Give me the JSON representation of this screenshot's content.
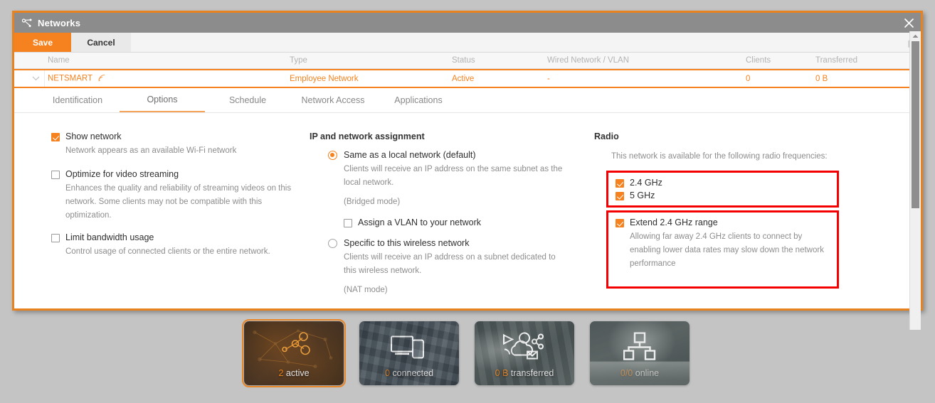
{
  "window": {
    "title": "Networks",
    "title_icon": "network-nodes-icon",
    "close_icon": "close-icon"
  },
  "toolbar": {
    "save_label": "Save",
    "cancel_label": "Cancel",
    "tools_icon": "wrench-icon"
  },
  "table": {
    "columns": [
      "Name",
      "Type",
      "Status",
      "Wired Network / VLAN",
      "Clients",
      "Transferred"
    ],
    "row": {
      "expander_icon": "chevron-down-icon",
      "name": "NETSMART",
      "name_icon": "wifi-icon",
      "type": "Employee Network",
      "status": "Active",
      "vlan": "-",
      "clients": "0",
      "transferred": "0 B"
    }
  },
  "tabs": [
    {
      "label": "Identification",
      "active": false
    },
    {
      "label": "Options",
      "active": true
    },
    {
      "label": "Schedule",
      "active": false
    },
    {
      "label": "Network Access",
      "active": false
    },
    {
      "label": "Applications",
      "active": false
    }
  ],
  "options_column": {
    "items": [
      {
        "label": "Show network",
        "checked": true,
        "desc": "Network appears as an available Wi-Fi network"
      },
      {
        "label": "Optimize for video streaming",
        "checked": false,
        "desc": "Enhances the quality and reliability of streaming videos on this network. Some clients may not be compatible with this optimization."
      },
      {
        "label": "Limit bandwidth usage",
        "checked": false,
        "desc": "Control usage of connected clients or the entire network."
      }
    ]
  },
  "ip_assignment": {
    "title": "IP and network assignment",
    "option_local": {
      "label": "Same as a local network (default)",
      "selected": true,
      "desc": "Clients will receive an IP address on the same subnet as the local network.",
      "mode": "(Bridged mode)"
    },
    "vlan_checkbox": {
      "label": "Assign a VLAN to your network",
      "checked": false
    },
    "option_specific": {
      "label": "Specific to this wireless network",
      "selected": false,
      "desc": "Clients will receive an IP address on a subnet dedicated to this wireless network.",
      "mode": "(NAT mode)"
    }
  },
  "radio": {
    "title": "Radio",
    "subtitle": "This network is available for the following radio frequencies:",
    "frequencies": [
      {
        "label": "2.4 GHz",
        "checked": true
      },
      {
        "label": "5 GHz",
        "checked": true
      }
    ],
    "extend": {
      "label": "Extend 2.4 GHz range",
      "checked": true,
      "desc": "Allowing far away 2.4 GHz clients to connect by enabling lower data rates may slow down the network performance"
    },
    "highlight_color": "#f40000"
  },
  "tiles": [
    {
      "number": "2",
      "label": "active",
      "selected": true,
      "icon": "network-graph-icon"
    },
    {
      "number": "0",
      "label": "connected",
      "selected": false,
      "icon": "devices-icon"
    },
    {
      "number": "0 B",
      "label": "transferred",
      "selected": false,
      "icon": "cloud-share-icon"
    },
    {
      "number": "0/0",
      "label": "online",
      "selected": false,
      "icon": "topology-icon"
    }
  ],
  "colors": {
    "accent": "#f5821f",
    "titlebar": "#8c8c8c",
    "page_bg": "#c4c4c4",
    "highlight": "#f40000"
  }
}
